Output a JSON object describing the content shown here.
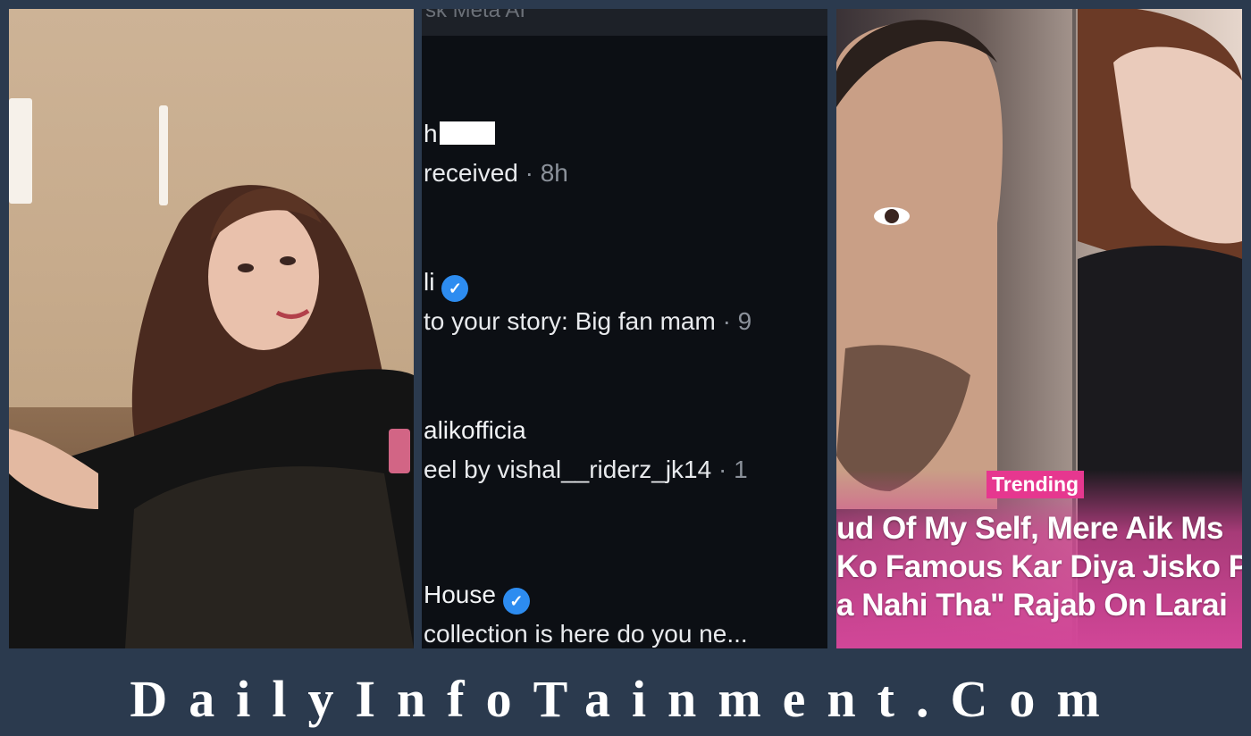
{
  "middle": {
    "topbar_text": "sk Meta AI",
    "notifications": [
      {
        "name": "h",
        "body": "received",
        "time": "· 8h"
      },
      {
        "name": "li",
        "body": " to your story: Big fan mam",
        "time": "· 9"
      },
      {
        "name": "alikofficia",
        "body": "eel by vishal__riderz_jk14",
        "time": "· 1"
      },
      {
        "name": "House",
        "body": "collection is here do you ne...",
        "time": ""
      }
    ]
  },
  "right": {
    "badge": "Trending",
    "headline": [
      "ud Of My Self, Mere Aik Ms",
      "Ko Famous Kar Diya Jisko P",
      "a Nahi Tha\" Rajab On Larai"
    ]
  },
  "footer": {
    "brand": "DailyInfoTainment.Com"
  }
}
